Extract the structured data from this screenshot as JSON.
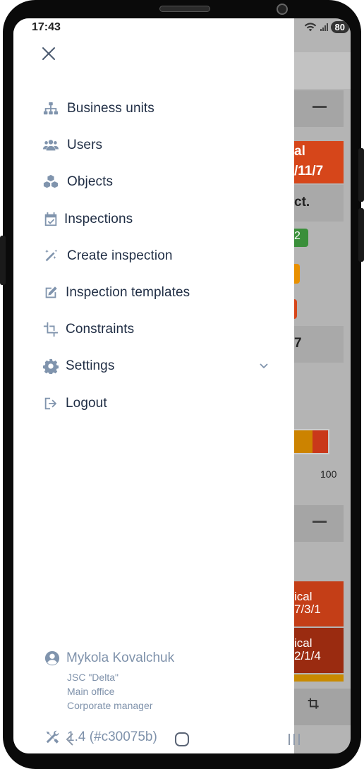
{
  "status_bar": {
    "time": "17:43",
    "battery": "80"
  },
  "drawer": {
    "menu": [
      {
        "label": "Business units",
        "icon": "sitemap-icon"
      },
      {
        "label": "Users",
        "icon": "users-icon"
      },
      {
        "label": "Objects",
        "icon": "cubes-icon"
      },
      {
        "label": "Inspections",
        "icon": "calendar-check-icon"
      },
      {
        "label": "Create inspection",
        "icon": "magic-wand-icon"
      },
      {
        "label": "Inspection templates",
        "icon": "edit-icon"
      },
      {
        "label": "Constraints",
        "icon": "crop-icon"
      },
      {
        "label": "Settings",
        "icon": "gear-icon"
      },
      {
        "label": "Logout",
        "icon": "logout-icon"
      }
    ],
    "profile": {
      "name": "Mykola Kovalchuk",
      "company": "JSC \"Delta\"",
      "office": "Main office",
      "role": "Corporate manager"
    },
    "version": "1.4 (#c30075b)"
  },
  "background_app": {
    "texts": [
      "al",
      "/11/7",
      "ct.",
      "2",
      "7",
      "100",
      "ical",
      "7/3/1",
      "ical",
      "2/1/4"
    ]
  },
  "colors": {
    "accent_text": "#1f2d44",
    "icon": "#8094ad",
    "orange_red": "#e2471b",
    "green": "#3aa53a",
    "orange": "#f08c00"
  }
}
